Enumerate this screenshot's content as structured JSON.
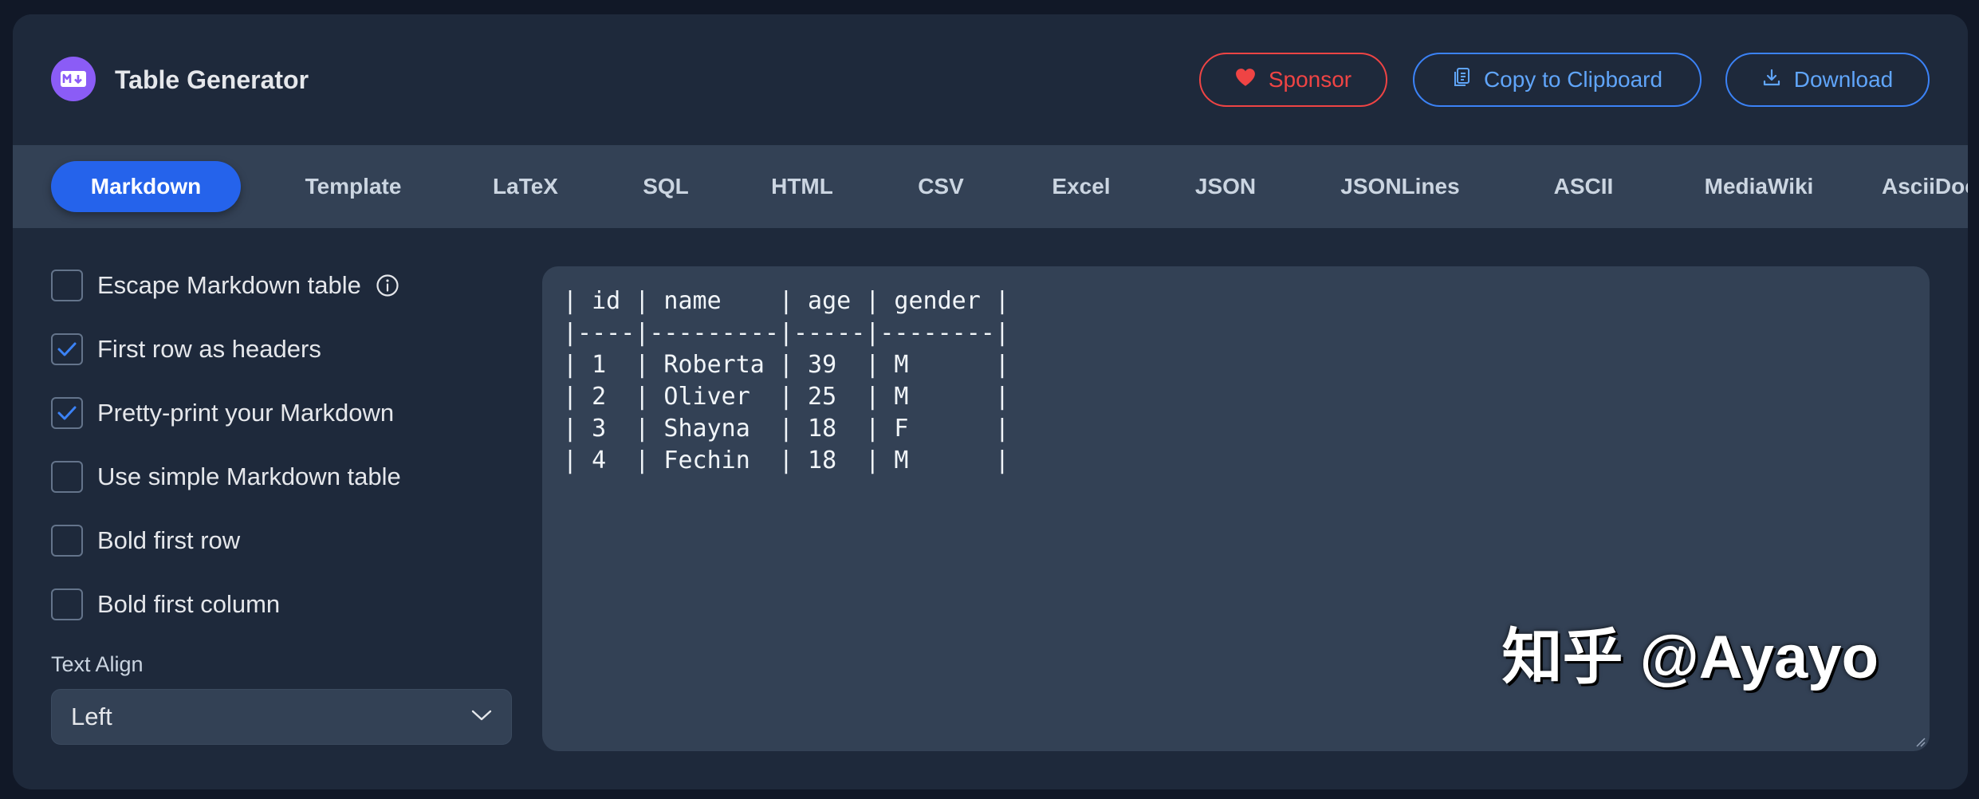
{
  "header": {
    "title": "Table Generator",
    "logo_icon": "markdown-icon",
    "buttons": {
      "sponsor": "Sponsor",
      "copy": "Copy to Clipboard",
      "download": "Download"
    }
  },
  "tabs": [
    {
      "label": "Markdown",
      "active": true
    },
    {
      "label": "Template"
    },
    {
      "label": "LaTeX"
    },
    {
      "label": "SQL"
    },
    {
      "label": "HTML"
    },
    {
      "label": "CSV"
    },
    {
      "label": "Excel"
    },
    {
      "label": "JSON"
    },
    {
      "label": "JSONLines"
    },
    {
      "label": "ASCII"
    },
    {
      "label": "MediaWiki"
    },
    {
      "label": "AsciiDoc"
    }
  ],
  "options": [
    {
      "label": "Escape Markdown table",
      "checked": false,
      "info": true
    },
    {
      "label": "First row as headers",
      "checked": true
    },
    {
      "label": "Pretty-print your Markdown",
      "checked": true
    },
    {
      "label": "Use simple Markdown table",
      "checked": false
    },
    {
      "label": "Bold first row",
      "checked": false
    },
    {
      "label": "Bold first column",
      "checked": false
    }
  ],
  "text_align": {
    "label": "Text Align",
    "value": "Left"
  },
  "output": "| id | name    | age | gender |\n|----|---------|-----|--------|\n| 1  | Roberta | 39  | M      |\n| 2  | Oliver  | 25  | M      |\n| 3  | Shayna  | 18  | F      |\n| 4  | Fechin  | 18  | M      |",
  "watermark": "知乎 @Ayayo",
  "colors": {
    "accent": "#2563eb",
    "sponsor": "#ef4444",
    "logo": "#8b5cf6",
    "background": "#1e293b"
  }
}
